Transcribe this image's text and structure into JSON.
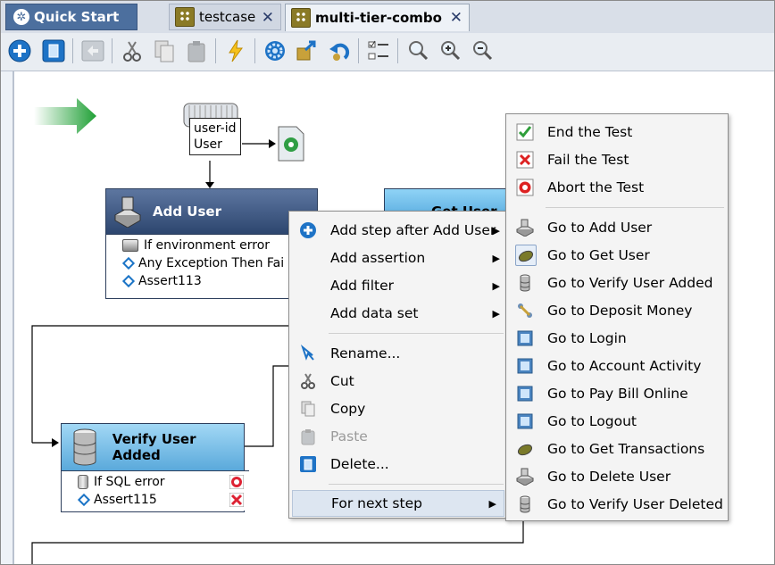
{
  "tabs": [
    {
      "label": "Quick Start"
    },
    {
      "label": "testcase"
    },
    {
      "label": "multi-tier-combo"
    }
  ],
  "toolbar": {
    "buttons": [
      "add-icon",
      "delete-icon",
      "back-icon",
      "cut-icon",
      "copy-icon",
      "paste-icon",
      "lightning-icon",
      "gear-icon",
      "export-icon",
      "undo-icon",
      "properties-icon",
      "zoom-icon",
      "zoom-in-icon",
      "zoom-out-icon"
    ]
  },
  "diagram": {
    "property_box": {
      "line1": "user-id",
      "line2": "User"
    },
    "add_user": {
      "title": "Add User",
      "rows": [
        "If environment error",
        "Any Exception Then Fai",
        "Assert113"
      ]
    },
    "get_user": {
      "title": "Get User"
    },
    "verify_user_added": {
      "title": "Verify User Added",
      "rows": [
        "If SQL error",
        "Assert115"
      ]
    }
  },
  "context_menu": {
    "items": [
      {
        "label": "Add step after Add User",
        "has_submenu": true
      },
      {
        "label": "Add assertion",
        "has_submenu": true
      },
      {
        "label": "Add filter",
        "has_submenu": true
      },
      {
        "label": "Add data set",
        "has_submenu": true
      },
      {
        "label": "Rename..."
      },
      {
        "label": "Cut"
      },
      {
        "label": "Copy"
      },
      {
        "label": "Paste",
        "disabled": true
      },
      {
        "label": "Delete..."
      },
      {
        "label": "For next step",
        "has_submenu": true,
        "highlighted": true
      }
    ]
  },
  "submenu": {
    "items": [
      {
        "label": "End the Test"
      },
      {
        "label": "Fail the Test"
      },
      {
        "label": "Abort the Test"
      },
      {
        "label": "Go to Add User"
      },
      {
        "label": "Go to Get User",
        "selected": true
      },
      {
        "label": "Go to Verify User Added"
      },
      {
        "label": "Go to Deposit Money"
      },
      {
        "label": "Go to Login"
      },
      {
        "label": "Go to Account Activity"
      },
      {
        "label": "Go to Pay Bill Online"
      },
      {
        "label": "Go to Logout"
      },
      {
        "label": "Go to Get Transactions"
      },
      {
        "label": "Go to Delete User"
      },
      {
        "label": "Go to Verify User Deleted"
      }
    ]
  },
  "colors": {
    "tab_active_bg": "#4c6f9e",
    "node_header": "#2d466f",
    "menu_bg": "#f4f4f4",
    "highlight": "#dde6f1"
  }
}
